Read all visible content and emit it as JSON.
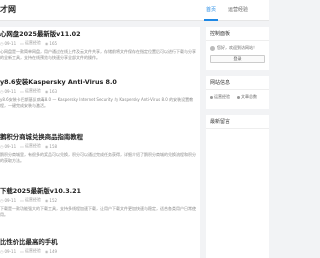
{
  "header": {
    "site_name": "才网",
    "nav": [
      {
        "label": "首页",
        "active": true
      },
      {
        "label": "运营经验",
        "active": false
      }
    ]
  },
  "posts": [
    {
      "title": "心网盘2025最新版v11.02",
      "date": "09-11",
      "category": "运营经验",
      "views": "165",
      "excerpt": "心网盘是一款简单网盘，用户通过在线上传及云文件共享，存储前将文件保存在指定位置后可以进行下载与分享的全新工具，支持在线预览与快速分享全部文件的操作。"
    },
    {
      "title": "y8.6安装Kaspersky Anti-Virus 8.0",
      "date": "09-11",
      "category": "运营经验",
      "views": "163",
      "excerpt": "y8.6安装卡巴斯基反病毒8.0 — Kaspersky Internet Security 与 Kaspersky Anti-Virus 8.0 的安装设置教程，一键完成安装与激活。"
    },
    {
      "title": "鹅积分商城兑换商品指南教程",
      "date": "09-11",
      "category": "运营经验",
      "views": "158",
      "excerpt": "鹅积分商城里，有很多的奖品可以兑换，积分可以通过完成任务获得，详细介绍了鹅积分商城的兑换流程和积分的获取方法。"
    },
    {
      "title": "下载2025最新版v10.3.21",
      "date": "09-11",
      "category": "运营经验",
      "views": "152",
      "excerpt": "下载是一款功能强大的下载工具，支持多线程加速下载，让用户下载文件更加快速与稳定，适合各类用户日常使用。"
    },
    {
      "title": "比性价比最高的手机",
      "date": "09-11",
      "category": "运营经验",
      "views": "149",
      "excerpt": ""
    }
  ],
  "sidebar": {
    "control_title": "控制面板",
    "greeting": "您好，欢迎到访网站！",
    "login_label": "登录",
    "stats_title": "网站信息",
    "stats": [
      "运营经验",
      "文章总数"
    ],
    "latest_title": "最新留言"
  }
}
